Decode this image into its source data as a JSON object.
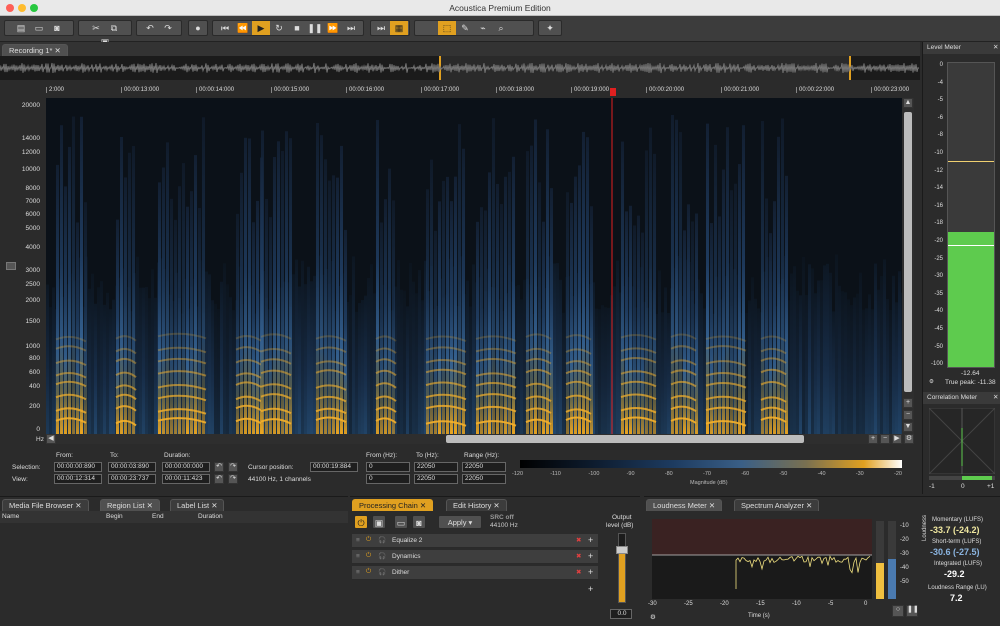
{
  "app": {
    "title": "Acoustica Premium Edition"
  },
  "colors": {
    "accent": "#e0a020",
    "meter_green": "#5ecb4e",
    "spectrogram_bg": "#0b1118",
    "spectrogram_blue": "#2b5a8c",
    "spectrogram_gold": "#f0a820",
    "marker_red": "#e02020"
  },
  "toolbar": {
    "icons": [
      "new-file-icon",
      "open-icon",
      "save-icon",
      "cut-icon",
      "copy-icon",
      "paste-icon",
      "undo-icon",
      "redo-icon",
      "record-icon",
      "go-start-icon",
      "rewind-icon",
      "play-icon",
      "loop-icon",
      "stop-icon",
      "pause-icon",
      "forward-icon",
      "go-end-icon",
      "skip-icon",
      "waveform-icon",
      "select-tool-icon",
      "pencil-icon",
      "pick-icon",
      "zoom-icon",
      "marker-icon"
    ]
  },
  "editor_tab": {
    "label": "Recording 1*"
  },
  "timeline": {
    "labels": [
      "2:000",
      "00:00:13:000",
      "00:00:14:000",
      "00:00:15:000",
      "00:00:16:000",
      "00:00:17:000",
      "00:00:18:000",
      "00:00:19:000",
      "00:00:20:000",
      "00:00:21:000",
      "00:00:22:000",
      "00:00:23:000"
    ]
  },
  "freq_axis": {
    "labels": [
      "20000",
      "14000",
      "12000",
      "10000",
      "8000",
      "7000",
      "6000",
      "5000",
      "4000",
      "3000",
      "2500",
      "2000",
      "1500",
      "1000",
      "800",
      "600",
      "400",
      "200",
      "0"
    ],
    "unit": "Hz"
  },
  "selection": {
    "from_label": "From:",
    "to_label": "To:",
    "duration_label": "Duration:",
    "selection_label": "Selection:",
    "view_label": "View:",
    "sel_from": "00:00:00:890",
    "sel_to": "00:00:03:890",
    "sel_duration": "00:00:00:000",
    "view_from": "00:00:12:314",
    "view_to": "00:00:23:737",
    "view_duration": "00:00:11:423",
    "cursor_label": "Cursor position:",
    "cursor_value": "00:00:19:884",
    "format": "44100 Hz, 1 channels",
    "fromhz_label": "From (Hz):",
    "tohz_label": "To (Hz):",
    "range_label": "Range (Hz):",
    "sel_fromhz": "0",
    "sel_tohz": "22050",
    "sel_range": "22050",
    "view_fromhz": "0",
    "view_tohz": "22050",
    "view_range": "22050"
  },
  "magnitude": {
    "ticks": [
      "-120",
      "-110",
      "-100",
      "-90",
      "-80",
      "-70",
      "-60",
      "-50",
      "-40",
      "-30",
      "-20"
    ],
    "label": "Magnitude (dB)"
  },
  "level_meter": {
    "title": "Level Meter",
    "scale": [
      "0",
      "-4",
      "-5",
      "-6",
      "-8",
      "-10",
      "-12",
      "-14",
      "-16",
      "-18",
      "-20",
      "-25",
      "-30",
      "-35",
      "-40",
      "-45",
      "-50",
      "-100"
    ],
    "value": "-12.64",
    "true_peak": "True peak: -11.38",
    "fill_fraction": 0.445
  },
  "correlation_meter": {
    "title": "Correlation Meter",
    "scale": [
      "-1",
      "0",
      "+1"
    ]
  },
  "bottom_left": {
    "tabs": [
      "Media File Browser",
      "Region List",
      "Label List"
    ],
    "columns": [
      "Name",
      "Begin",
      "End",
      "Duration"
    ]
  },
  "processing": {
    "tabs": [
      "Processing Chain",
      "Edit History"
    ],
    "apply_label": "Apply",
    "src_title": "SRC off",
    "src_rate": "44100 Hz",
    "output_label": "Output",
    "output_label2": "level (dB)",
    "output_value": "0.0",
    "chain": [
      "Equalize 2",
      "Dynamics",
      "Dither"
    ]
  },
  "loudness": {
    "tabs": [
      "Loudness Meter",
      "Spectrum Analyzer"
    ],
    "x_ticks": [
      "-30",
      "-25",
      "-20",
      "-15",
      "-10",
      "-5",
      "0"
    ],
    "x_label": "Time (s)",
    "y_ticks": [
      "-10",
      "-20",
      "-30",
      "-40",
      "-50"
    ],
    "y_label": "Loudness",
    "momentary_label": "Momentary (LUFS)",
    "momentary_value": "-33.7 (-24.2)",
    "short_label": "Short-term (LUFS)",
    "short_value": "-30.6 (-27.5)",
    "integrated_label": "Integrated (LUFS)",
    "integrated_value": "-29.2",
    "range_label": "Loudness Range (LU)",
    "range_value": "7.2"
  }
}
